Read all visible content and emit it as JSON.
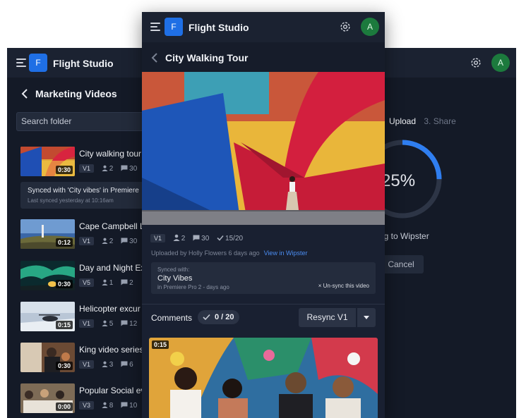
{
  "app": {
    "name": "Flight Studio",
    "logo_letter": "F",
    "avatar_letter": "A",
    "accent": "#1f6fe5"
  },
  "back_panel": {
    "title": "Marketing Videos",
    "search_placeholder": "Search folder",
    "videos": [
      {
        "name": "City walking tour",
        "duration": "0:30",
        "version": "V1",
        "people": "2",
        "comments": "30"
      },
      {
        "name": "Cape Campbell L",
        "duration": "0:12",
        "version": "V1",
        "people": "2",
        "comments": "30"
      },
      {
        "name": "Day and Night Ex",
        "duration": "0:30",
        "version": "V5",
        "people": "1",
        "comments": "2"
      },
      {
        "name": "Helicopter excur",
        "duration": "0:15",
        "version": "V1",
        "people": "5",
        "comments": "12"
      },
      {
        "name": "King video series",
        "duration": "0:30",
        "version": "V1",
        "people": "3",
        "comments": "6"
      },
      {
        "name": "Popular Social ev",
        "duration": "0:00",
        "version": "V3",
        "people": "8",
        "comments": "10"
      }
    ],
    "sync_note": {
      "line1": "Synced with 'City vibes' in Premiere",
      "line2": "Last synced yesterday at 10:16am"
    },
    "steps": {
      "active": "Upload",
      "next": "3. Share"
    },
    "progress": {
      "label": "25%",
      "value": 0.25,
      "subtitle": "ng to Wipster",
      "cancel": "Cancel"
    }
  },
  "front_panel": {
    "title": "City Walking Tour",
    "version": "V1",
    "people": "2",
    "comments": "30",
    "approvals": "15/20",
    "uploaded_by": "Uploaded by Holly Flowers 6 days ago",
    "view_link": "View in Wipster",
    "sync": {
      "label": "Synced with:",
      "name": "City Vibes",
      "detail": "in Premiere Pro 2 - days ago",
      "unsync": "× Un-sync this video"
    },
    "comments_bar": {
      "label": "Comments",
      "count": "0 / 20",
      "resync": "Resync V1"
    },
    "comment_thumb_duration": "0:15"
  },
  "icons": [
    "hamburger-icon",
    "gear-icon",
    "chevron-left-icon",
    "person-icon",
    "comment-icon",
    "check-icon",
    "chevron-down-icon"
  ]
}
